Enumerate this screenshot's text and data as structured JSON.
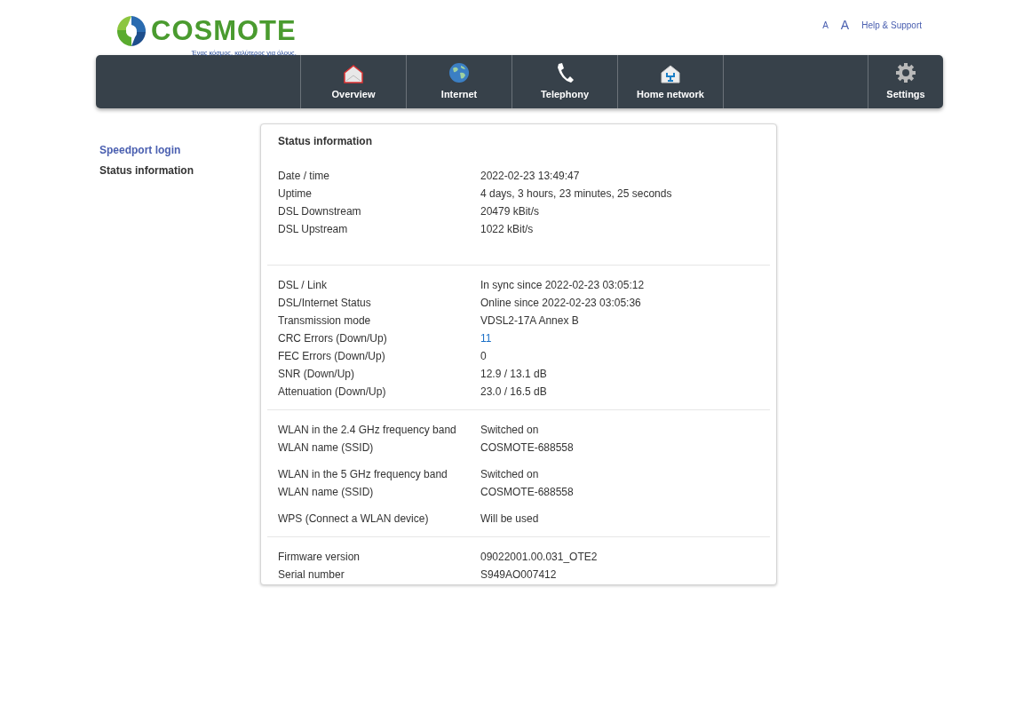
{
  "logo": {
    "brand": "COSMOTE",
    "tagline": "Ένας κόσμος, καλύτερος για όλους."
  },
  "top_links": [
    {
      "label": "A",
      "kind": "small"
    },
    {
      "label": "A",
      "kind": "large"
    },
    {
      "label": "Help & Support",
      "kind": "link"
    }
  ],
  "nav": [
    {
      "label": "Overview",
      "kind": "home"
    },
    {
      "label": "Internet",
      "kind": "globe"
    },
    {
      "label": "Telephony",
      "kind": "phone"
    },
    {
      "label": "Home network",
      "kind": "network"
    },
    {
      "label": "Settings",
      "kind": "gear"
    }
  ],
  "sidebar": {
    "items": [
      {
        "label": "Speedport login",
        "selected": false
      },
      {
        "label": "Status information",
        "selected": true
      }
    ]
  },
  "status": {
    "title": "Status information",
    "sections": [
      {
        "groups": [
          [
            {
              "label": "Date / time",
              "value": "2022-02-23 13:49:47",
              "kind": "text"
            },
            {
              "label": "Uptime",
              "value": "4 days, 3 hours, 23 minutes, 25 seconds",
              "kind": "text"
            },
            {
              "label": "DSL Downstream",
              "value": "20479 kBit/s",
              "kind": "text"
            },
            {
              "label": "DSL Upstream",
              "value": "1022 kBit/s",
              "kind": "text"
            }
          ]
        ]
      },
      {
        "groups": [
          [
            {
              "label": "DSL / Link",
              "value": "In sync since 2022-02-23 03:05:12",
              "kind": "text"
            },
            {
              "label": "DSL/Internet Status",
              "value": "Online since 2022-02-23 03:05:36",
              "kind": "text"
            },
            {
              "label": "Transmission mode",
              "value": "VDSL2-17A Annex B",
              "kind": "text"
            },
            {
              "label": "CRC Errors (Down/Up)",
              "value": "11",
              "kind": "link"
            },
            {
              "label": "FEC Errors (Down/Up)",
              "value": "0",
              "kind": "text"
            },
            {
              "label": "SNR (Down/Up)",
              "value": "12.9 / 13.1 dB",
              "kind": "text"
            },
            {
              "label": "Attenuation (Down/Up)",
              "value": "23.0 / 16.5 dB",
              "kind": "text"
            }
          ]
        ]
      },
      {
        "groups": [
          [
            {
              "label": "WLAN in the 2.4 GHz frequency band",
              "value": "Switched on",
              "kind": "text"
            },
            {
              "label": "WLAN name (SSID)",
              "value": "COSMOTE-688558",
              "kind": "text"
            }
          ],
          [
            {
              "label": "WLAN in the 5 GHz frequency band",
              "value": "Switched on",
              "kind": "text"
            },
            {
              "label": "WLAN name (SSID)",
              "value": "COSMOTE-688558",
              "kind": "text"
            }
          ],
          [
            {
              "label": "WPS (Connect a WLAN device)",
              "value": "Will be used",
              "kind": "text"
            }
          ]
        ]
      },
      {
        "groups": [
          [
            {
              "label": "Firmware version",
              "value": "09022001.00.031_OTE2",
              "kind": "text"
            },
            {
              "label": "Serial number",
              "value": "S949AO007412",
              "kind": "text"
            }
          ]
        ]
      }
    ]
  }
}
